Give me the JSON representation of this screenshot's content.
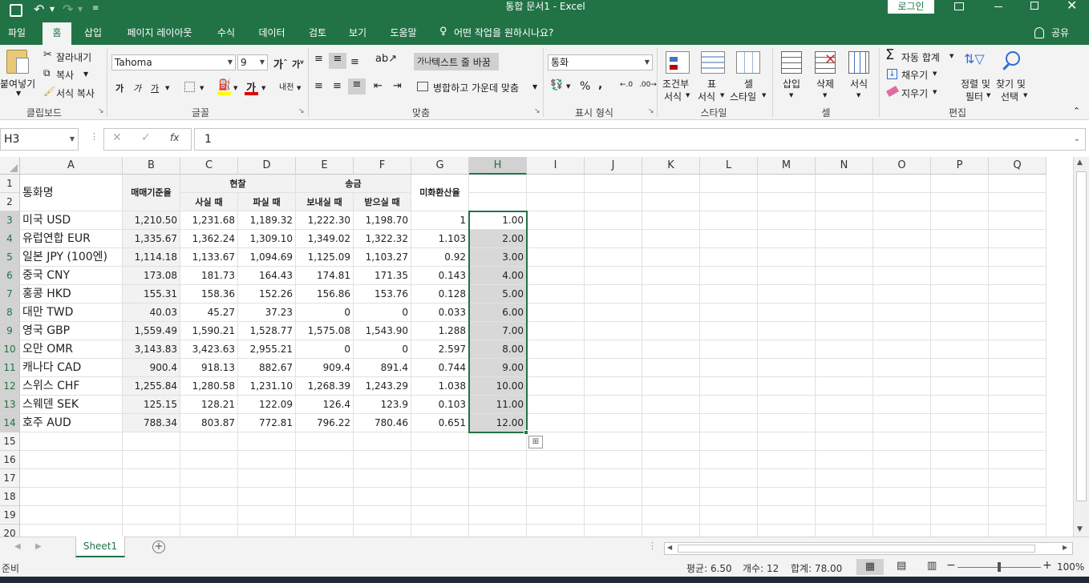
{
  "title_bar": {
    "document_title": "통합 문서1  -  Excel",
    "signin_label": "로그인"
  },
  "ribbon_tabs": [
    "파일",
    "홈",
    "삽입",
    "페이지 레이아웃",
    "수식",
    "데이터",
    "검토",
    "보기",
    "도움말"
  ],
  "tell_me": "어떤 작업을 원하시나요?",
  "share_label": "공유",
  "clipboard": {
    "paste": "붙여넣기",
    "cut": "잘라내기",
    "copy": "복사",
    "format_painter": "서식 복사",
    "group": "클립보드"
  },
  "font": {
    "name": "Tahoma",
    "size": "9",
    "group": "글꼴"
  },
  "alignment": {
    "wrap": "텍스트 줄 바꿈",
    "merge": "병합하고 가운데 맞춤",
    "group": "맞춤"
  },
  "number": {
    "format": "통화",
    "group": "표시 형식"
  },
  "styles": {
    "cond_line1": "조건부",
    "cond_line2": "서식",
    "table_line1": "표",
    "table_line2": "서식",
    "cell_line1": "셀",
    "cell_line2": "스타일",
    "group": "스타일"
  },
  "cells": {
    "insert": "삽입",
    "delete": "삭제",
    "format": "서식",
    "group": "셀"
  },
  "editing": {
    "autosum": "자동 합계",
    "fill": "채우기",
    "clear": "지우기",
    "sort_line1": "정렬 및",
    "sort_line2": "필터",
    "find_line1": "찾기 및",
    "find_line2": "선택",
    "group": "편집"
  },
  "formula_bar": {
    "name_box": "H3",
    "fx": "fx",
    "value": "1"
  },
  "columns": [
    "A",
    "B",
    "C",
    "D",
    "E",
    "F",
    "G",
    "H",
    "I",
    "J",
    "K",
    "L",
    "M",
    "N",
    "O",
    "P",
    "Q"
  ],
  "rows": [
    "1",
    "2",
    "3",
    "4",
    "5",
    "6",
    "7",
    "8",
    "9",
    "10",
    "11",
    "12",
    "13",
    "14",
    "15",
    "16",
    "17",
    "18",
    "19",
    "20"
  ],
  "headers": {
    "currency_name": "통화명",
    "base_rate": "매매기준율",
    "cash": "현찰",
    "buy": "사실 때",
    "sell": "파실 때",
    "transfer": "송금",
    "send": "보내실 때",
    "receive": "받으실 때",
    "usd_rate": "미화환산율"
  },
  "table_rows": [
    {
      "name": "미국 USD",
      "b": "1,210.50",
      "c": "1,231.68",
      "d": "1,189.32",
      "e": "1,222.30",
      "f": "1,198.70",
      "g": "1",
      "h": "1.00"
    },
    {
      "name": "유럽연합 EUR",
      "b": "1,335.67",
      "c": "1,362.24",
      "d": "1,309.10",
      "e": "1,349.02",
      "f": "1,322.32",
      "g": "1.103",
      "h": "2.00"
    },
    {
      "name": "일본 JPY (100엔)",
      "b": "1,114.18",
      "c": "1,133.67",
      "d": "1,094.69",
      "e": "1,125.09",
      "f": "1,103.27",
      "g": "0.92",
      "h": "3.00"
    },
    {
      "name": "중국 CNY",
      "b": "173.08",
      "c": "181.73",
      "d": "164.43",
      "e": "174.81",
      "f": "171.35",
      "g": "0.143",
      "h": "4.00"
    },
    {
      "name": "홍콩 HKD",
      "b": "155.31",
      "c": "158.36",
      "d": "152.26",
      "e": "156.86",
      "f": "153.76",
      "g": "0.128",
      "h": "5.00"
    },
    {
      "name": "대만 TWD",
      "b": "40.03",
      "c": "45.27",
      "d": "37.23",
      "e": "0",
      "f": "0",
      "g": "0.033",
      "h": "6.00"
    },
    {
      "name": "영국 GBP",
      "b": "1,559.49",
      "c": "1,590.21",
      "d": "1,528.77",
      "e": "1,575.08",
      "f": "1,543.90",
      "g": "1.288",
      "h": "7.00"
    },
    {
      "name": "오만 OMR",
      "b": "3,143.83",
      "c": "3,423.63",
      "d": "2,955.21",
      "e": "0",
      "f": "0",
      "g": "2.597",
      "h": "8.00"
    },
    {
      "name": "캐나다 CAD",
      "b": "900.4",
      "c": "918.13",
      "d": "882.67",
      "e": "909.4",
      "f": "891.4",
      "g": "0.744",
      "h": "9.00"
    },
    {
      "name": "스위스 CHF",
      "b": "1,255.84",
      "c": "1,280.58",
      "d": "1,231.10",
      "e": "1,268.39",
      "f": "1,243.29",
      "g": "1.038",
      "h": "10.00"
    },
    {
      "name": "스웨덴 SEK",
      "b": "125.15",
      "c": "128.21",
      "d": "122.09",
      "e": "126.4",
      "f": "123.9",
      "g": "0.103",
      "h": "11.00"
    },
    {
      "name": "호주 AUD",
      "b": "788.34",
      "c": "803.87",
      "d": "772.81",
      "e": "796.22",
      "f": "780.46",
      "g": "0.651",
      "h": "12.00"
    }
  ],
  "sheet_tab": "Sheet1",
  "status": {
    "ready": "준비",
    "average": "평균: 6.50",
    "count": "개수: 12",
    "sum": "합계: 78.00",
    "zoom": "100%"
  },
  "colors": {
    "accent": "#217346",
    "ribbon_bg": "#f3f3f3",
    "selection_fill": "#d8d8d8"
  }
}
